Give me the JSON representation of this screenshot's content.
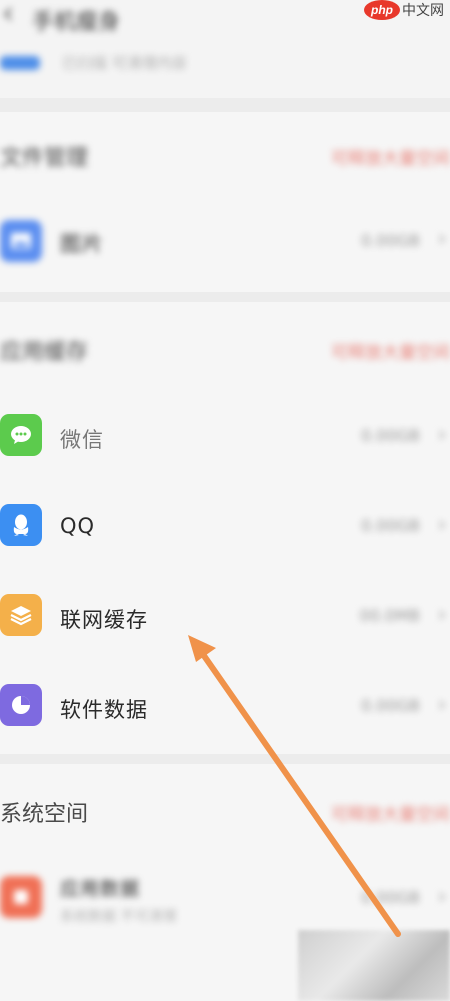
{
  "header": {
    "back_glyph": "‹",
    "title": "手机瘦身"
  },
  "summary": {
    "subtitle": "已扫描 可清理内容"
  },
  "sections": [
    {
      "title": "文件管理",
      "link": "可释放大量空间"
    },
    {
      "title": "应用缓存",
      "link": "可释放大量空间"
    },
    {
      "title": "系统空间",
      "link": "可释放大量空间"
    }
  ],
  "rows": {
    "pictures": {
      "label": "图片",
      "size": "0.00GB",
      "icon": "image-icon",
      "color": "#5b8ef0"
    },
    "wechat": {
      "label": "微信",
      "size": "0.00GB",
      "icon": "wechat-icon",
      "color": "#5ccb4d"
    },
    "qq": {
      "label": "QQ",
      "size": "0.00GB",
      "icon": "qq-penguin-icon",
      "color": "#3c8ff2"
    },
    "web_cache": {
      "label": "联网缓存",
      "size": "00.0MB",
      "icon": "layers-icon",
      "color": "#f4b04a"
    },
    "app_data": {
      "label": "软件数据",
      "size": "0.00GB",
      "icon": "pie-chart-icon",
      "color": "#7e6ae0"
    },
    "system_app": {
      "label": "应用数据",
      "sublabel": "系统数据 不可清理",
      "size": "0.00GB",
      "icon": "system-icon",
      "color": "#f07056"
    }
  },
  "watermark": {
    "brand": "php",
    "site": "中文网"
  },
  "chevron": "›",
  "annotation": {
    "color": "#f0924a"
  }
}
